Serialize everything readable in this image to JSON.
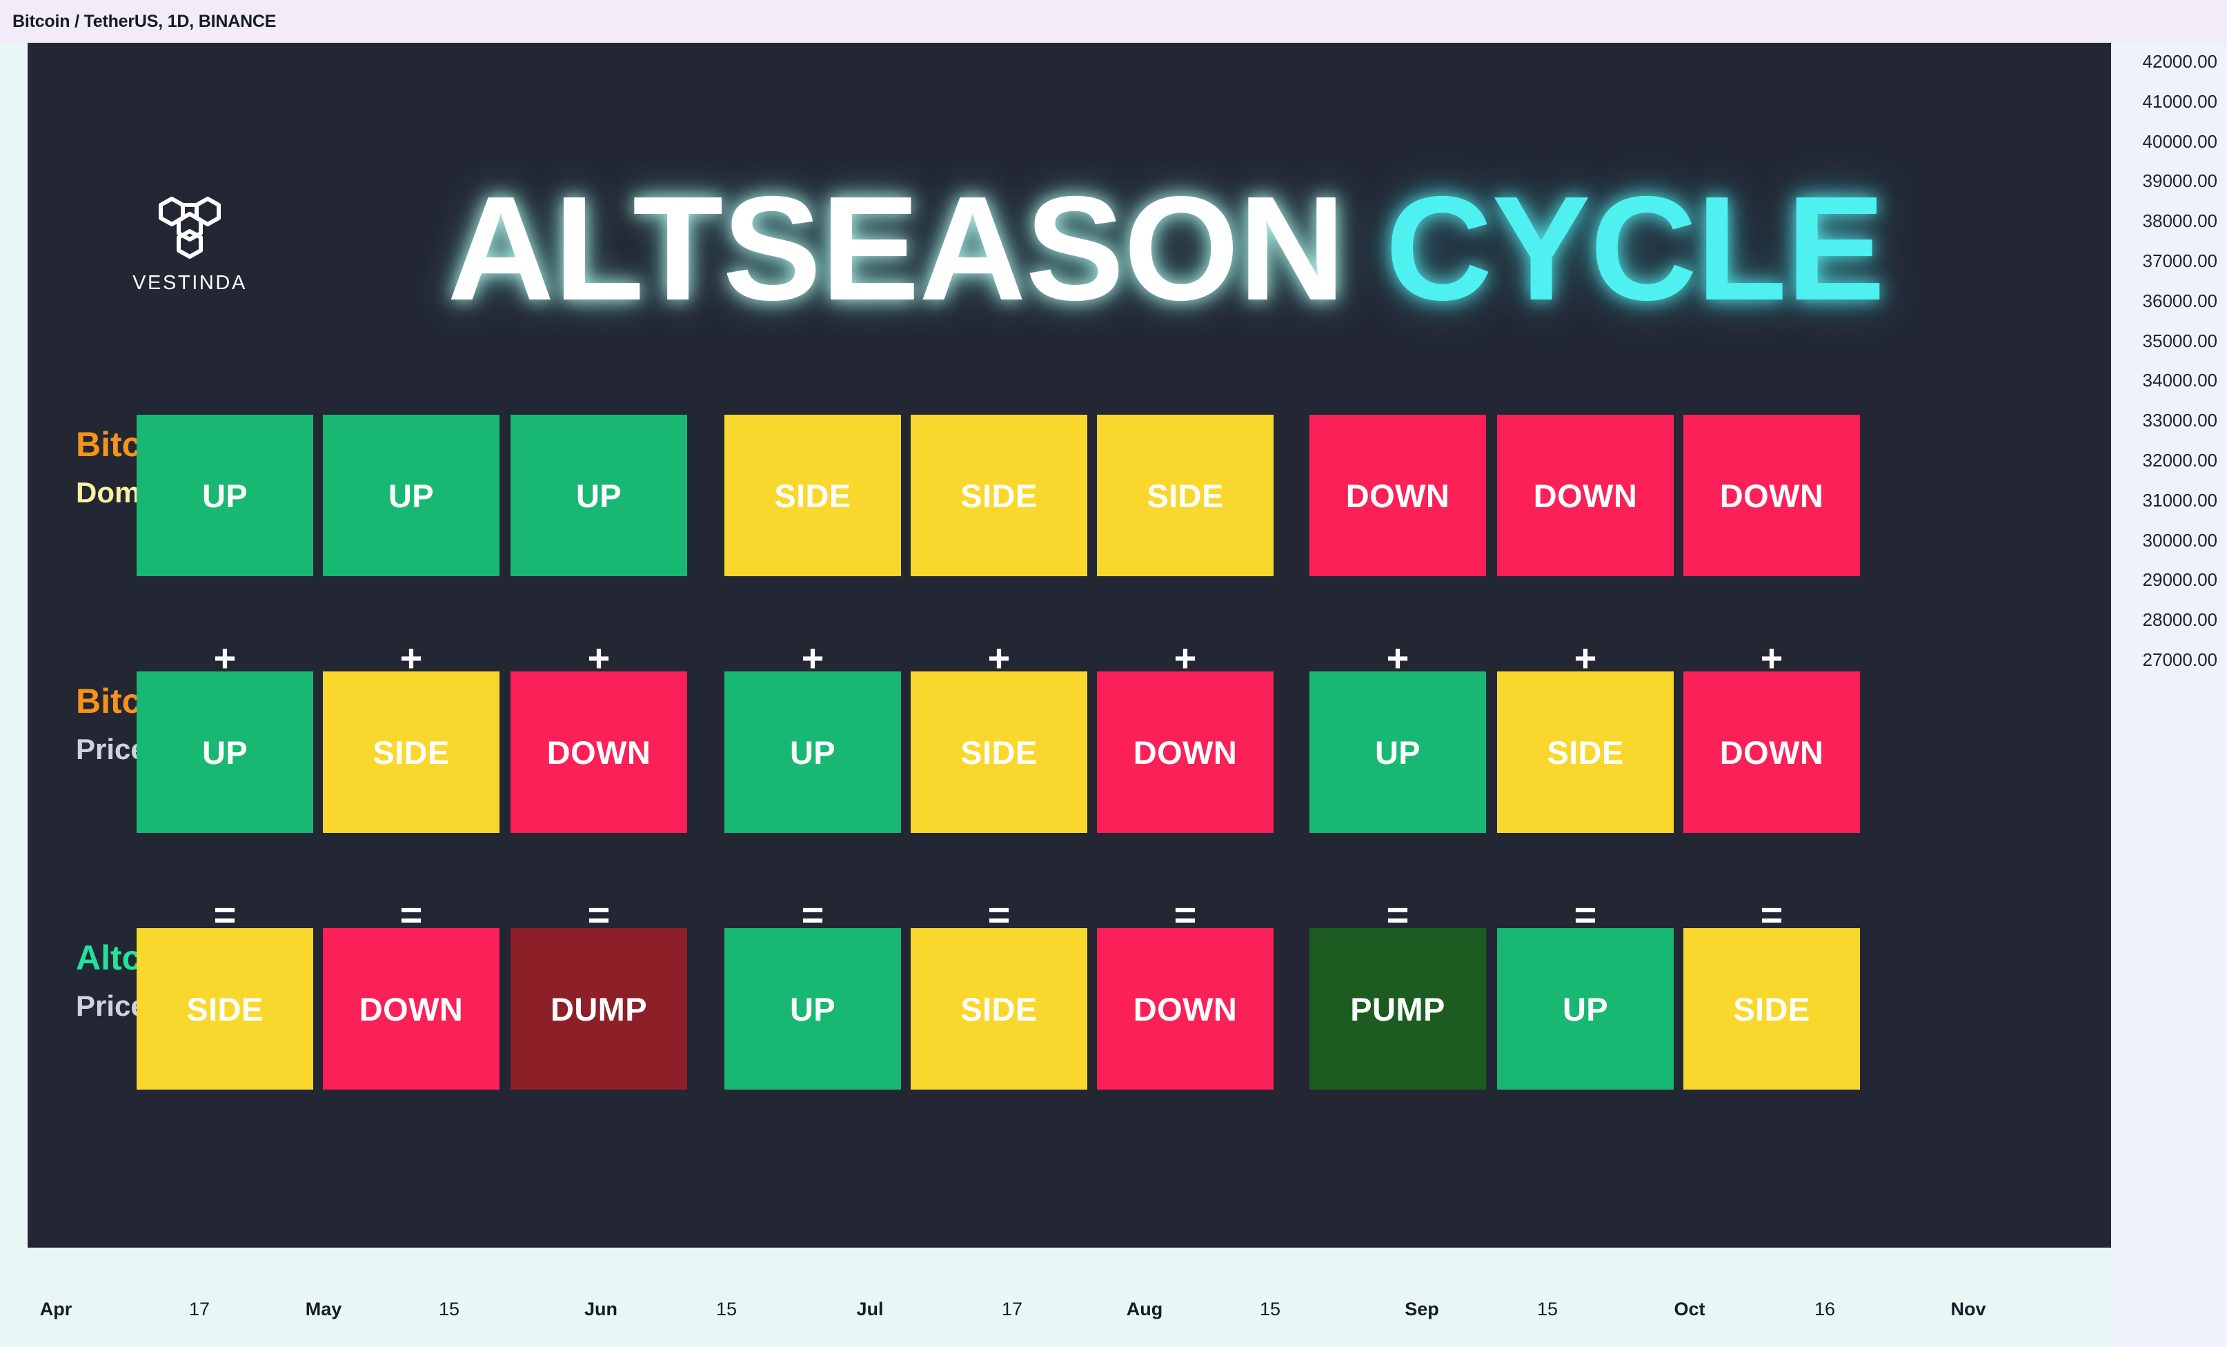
{
  "symbol_bar": {
    "title": "Bitcoin / TetherUS, 1D, BINANCE"
  },
  "brand": {
    "name": "VESTINDA",
    "logo_icon": "hexagon-trio-icon"
  },
  "headline": {
    "part1": "ALTSEASON",
    "part2": " CYCLE"
  },
  "colors": {
    "panel_bg": "#232734",
    "up": "#18b873",
    "side": "#fad72c",
    "down": "#fb2057",
    "pump": "#1d5c21",
    "dump": "#8c1f27",
    "accent_orange": "#f79418",
    "accent_yellow": "#fbf0a4",
    "accent_green": "#23e29a",
    "accent_silver": "#ced3dd",
    "headline_cyan": "#4ff0f0"
  },
  "rows": [
    {
      "label_line1": "Bitcoin",
      "label_line2": "Dominance",
      "label_color1": "#f79418",
      "label_color2": "#fbf0a4",
      "cells": [
        "UP",
        "UP",
        "UP",
        "SIDE",
        "SIDE",
        "SIDE",
        "DOWN",
        "DOWN",
        "DOWN"
      ]
    },
    {
      "label_line1": "Bitcoin",
      "label_line2": "Price",
      "label_color1": "#f79418",
      "label_color2": "#ced3dd",
      "cells": [
        "UP",
        "SIDE",
        "DOWN",
        "UP",
        "SIDE",
        "DOWN",
        "UP",
        "SIDE",
        "DOWN"
      ]
    },
    {
      "label_line1": "Altcoins",
      "label_line2": "Price",
      "label_color1": "#23e29a",
      "label_color2": "#ced3dd",
      "cells": [
        "SIDE",
        "DOWN",
        "DUMP",
        "UP",
        "SIDE",
        "DOWN",
        "PUMP",
        "UP",
        "SIDE"
      ]
    }
  ],
  "operators": {
    "plus": [
      "+",
      "+",
      "+",
      "+",
      "+",
      "+",
      "+",
      "+",
      "+"
    ],
    "equals": [
      "=",
      "=",
      "=",
      "=",
      "=",
      "=",
      "=",
      "=",
      "="
    ]
  },
  "chart_data": {
    "type": "table",
    "title": "ALTSEASON CYCLE",
    "symbol": "Bitcoin / TetherUS, 1D, BINANCE",
    "price_axis": {
      "ticks": [
        "42000.00",
        "41000.00",
        "40000.00",
        "39000.00",
        "38000.00",
        "37000.00",
        "36000.00",
        "35000.00",
        "34000.00",
        "33000.00",
        "32000.00",
        "31000.00",
        "30000.00",
        "29000.00",
        "28000.00",
        "27000.00"
      ],
      "ylim": [
        27000,
        42000
      ],
      "position": "right"
    },
    "time_axis": {
      "ticks": [
        "Apr",
        "17",
        "May",
        "15",
        "Jun",
        "15",
        "Jul",
        "17",
        "Aug",
        "15",
        "Sep",
        "15",
        "Oct",
        "16",
        "Nov"
      ],
      "position": "bottom"
    },
    "rows": [
      "Bitcoin Dominance",
      "Bitcoin Price",
      "Altcoins Price"
    ],
    "scenarios": [
      {
        "btc_dominance": "UP",
        "btc_price": "UP",
        "altcoins": "SIDE"
      },
      {
        "btc_dominance": "UP",
        "btc_price": "SIDE",
        "altcoins": "DOWN"
      },
      {
        "btc_dominance": "UP",
        "btc_price": "DOWN",
        "altcoins": "DUMP"
      },
      {
        "btc_dominance": "SIDE",
        "btc_price": "UP",
        "altcoins": "UP"
      },
      {
        "btc_dominance": "SIDE",
        "btc_price": "SIDE",
        "altcoins": "SIDE"
      },
      {
        "btc_dominance": "SIDE",
        "btc_price": "DOWN",
        "altcoins": "DOWN"
      },
      {
        "btc_dominance": "DOWN",
        "btc_price": "UP",
        "altcoins": "PUMP"
      },
      {
        "btc_dominance": "DOWN",
        "btc_price": "SIDE",
        "altcoins": "UP"
      },
      {
        "btc_dominance": "DOWN",
        "btc_price": "DOWN",
        "altcoins": "SIDE"
      }
    ]
  }
}
